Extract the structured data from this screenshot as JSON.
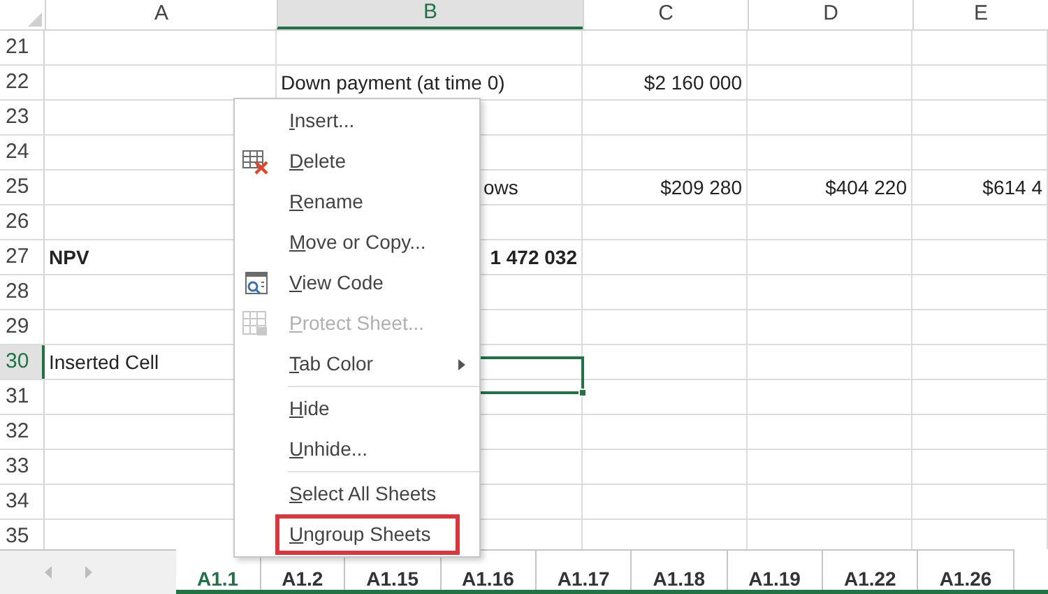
{
  "columns": [
    {
      "label": "A",
      "selected": false
    },
    {
      "label": "B",
      "selected": true
    },
    {
      "label": "C",
      "selected": false
    },
    {
      "label": "D",
      "selected": false
    },
    {
      "label": "E",
      "selected": false
    }
  ],
  "rows": [
    {
      "number": "21",
      "selected": false
    },
    {
      "number": "22",
      "selected": false,
      "B": {
        "kind": "text",
        "text": "Down payment (at time 0)",
        "bold": false
      },
      "C": {
        "kind": "number",
        "text": "$2 160 000",
        "bold": false
      }
    },
    {
      "number": "23",
      "selected": false
    },
    {
      "number": "24",
      "selected": false
    },
    {
      "number": "25",
      "selected": false,
      "B": {
        "kind": "overflow",
        "text": "ows",
        "bold": false
      },
      "C": {
        "kind": "number",
        "text": "$209 280",
        "bold": false
      },
      "D": {
        "kind": "number",
        "text": "$404 220",
        "bold": false
      },
      "E": {
        "kind": "number",
        "text": "$614 4",
        "bold": false
      }
    },
    {
      "number": "26",
      "selected": false
    },
    {
      "number": "27",
      "selected": false,
      "A": {
        "kind": "text",
        "text": "NPV",
        "bold": true
      },
      "B": {
        "kind": "number",
        "text": "1 472 032",
        "bold": true
      }
    },
    {
      "number": "28",
      "selected": false
    },
    {
      "number": "29",
      "selected": false
    },
    {
      "number": "30",
      "selected": true,
      "A": {
        "kind": "text",
        "text": "Inserted Cell",
        "bold": false
      }
    },
    {
      "number": "31",
      "selected": false
    },
    {
      "number": "32",
      "selected": false
    },
    {
      "number": "33",
      "selected": false
    },
    {
      "number": "34",
      "selected": false
    },
    {
      "number": "35",
      "selected": false
    }
  ],
  "sheet_tabs": [
    {
      "label": "A1.1",
      "selected": true
    },
    {
      "label": "A1.2",
      "selected": false
    },
    {
      "label": "A1.15",
      "selected": false
    },
    {
      "label": "A1.16",
      "selected": false
    },
    {
      "label": "A1.17",
      "selected": false
    },
    {
      "label": "A1.18",
      "selected": false
    },
    {
      "label": "A1.19",
      "selected": false
    },
    {
      "label": "A1.22",
      "selected": false
    },
    {
      "label": "A1.26",
      "selected": false
    }
  ],
  "context_menu": [
    {
      "kind": "plain",
      "label": "Insert...",
      "disabled": false,
      "submenu": false,
      "highlighted": false
    },
    {
      "kind": "delete",
      "label": "Delete",
      "disabled": false,
      "submenu": false,
      "highlighted": false
    },
    {
      "kind": "plain",
      "label": "Rename",
      "disabled": false,
      "submenu": false,
      "highlighted": false
    },
    {
      "kind": "plain",
      "label": "Move or Copy...",
      "disabled": false,
      "submenu": false,
      "highlighted": false
    },
    {
      "kind": "code",
      "label": "View Code",
      "disabled": false,
      "submenu": false,
      "highlighted": false
    },
    {
      "kind": "protect",
      "label": "Protect Sheet...",
      "disabled": true,
      "submenu": false,
      "highlighted": false
    },
    {
      "kind": "plain",
      "label": "Tab Color",
      "disabled": false,
      "submenu": true,
      "highlighted": false
    },
    {
      "kind": "separator"
    },
    {
      "kind": "plain",
      "label": "Hide",
      "disabled": false,
      "submenu": false,
      "highlighted": false
    },
    {
      "kind": "plain",
      "label": "Unhide...",
      "disabled": false,
      "submenu": false,
      "highlighted": false
    },
    {
      "kind": "separator"
    },
    {
      "kind": "plain",
      "label": "Select All Sheets",
      "disabled": false,
      "submenu": false,
      "highlighted": false
    },
    {
      "kind": "plain",
      "label": "Ungroup Sheets",
      "disabled": false,
      "submenu": false,
      "highlighted": true
    }
  ]
}
